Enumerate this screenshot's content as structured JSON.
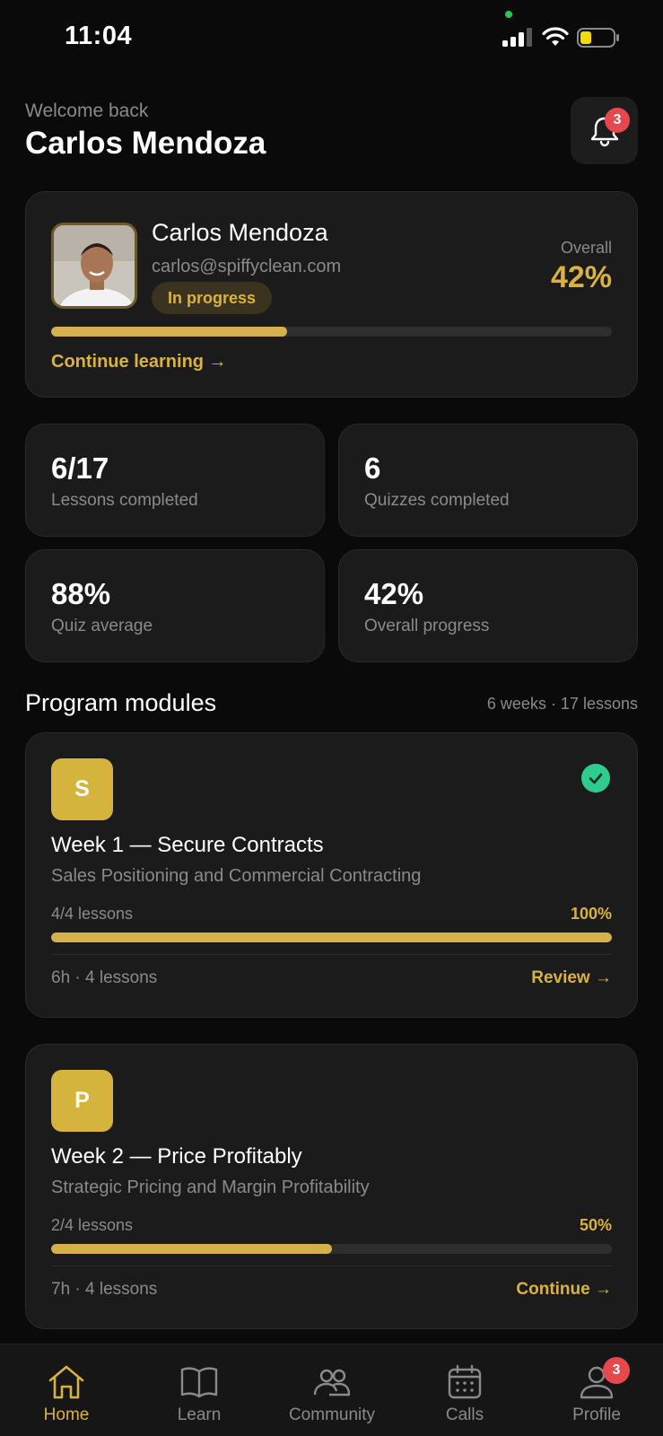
{
  "status_bar": {
    "time": "11:04"
  },
  "header": {
    "welcome": "Welcome back",
    "name": "Carlos Mendoza",
    "notification_count": "3"
  },
  "profile_card": {
    "name": "Carlos Mendoza",
    "email": "carlos@spiffyclean.com",
    "status": "In progress",
    "overall_label": "Overall",
    "overall_value": "42%",
    "progress": 0.42,
    "link": "Continue learning →"
  },
  "stats": [
    {
      "value": "6/17",
      "label": "Lessons completed"
    },
    {
      "value": "6",
      "label": "Quizzes completed"
    },
    {
      "value": "88%",
      "label": "Quiz average"
    },
    {
      "value": "42%",
      "label": "Overall progress"
    }
  ],
  "modules_section": {
    "title": "Program modules",
    "meta": "6 weeks · 17 lessons"
  },
  "modules": [
    {
      "letter": "S",
      "title": "Week 1 — Secure Contracts",
      "subtitle": "Sales Positioning and Commercial Contracting",
      "lessons": "4/4 lessons",
      "percent": "100%",
      "progress": 1.0,
      "footer": "6h · 4 lessons",
      "action": "Review →",
      "completed": true
    },
    {
      "letter": "P",
      "title": "Week 2 — Price Profitably",
      "subtitle": "Strategic Pricing and Margin Profitability",
      "lessons": "2/4 lessons",
      "percent": "50%",
      "progress": 0.5,
      "footer": "7h · 4 lessons",
      "action": "Continue →",
      "completed": false
    }
  ],
  "tabbar": {
    "tabs": [
      {
        "label": "Home",
        "icon": "home-icon",
        "active": true
      },
      {
        "label": "Learn",
        "icon": "book-icon",
        "active": false
      },
      {
        "label": "Community",
        "icon": "people-icon",
        "active": false
      },
      {
        "label": "Calls",
        "icon": "calendar-icon",
        "active": false
      },
      {
        "label": "Profile",
        "icon": "person-icon",
        "active": false
      }
    ],
    "profile_badge": "3"
  },
  "colors": {
    "accent": "#d9b23f",
    "background": "#0a0a0a",
    "card": "#1b1b1b",
    "success": "#2ecc8f",
    "badge": "#e5484d"
  }
}
